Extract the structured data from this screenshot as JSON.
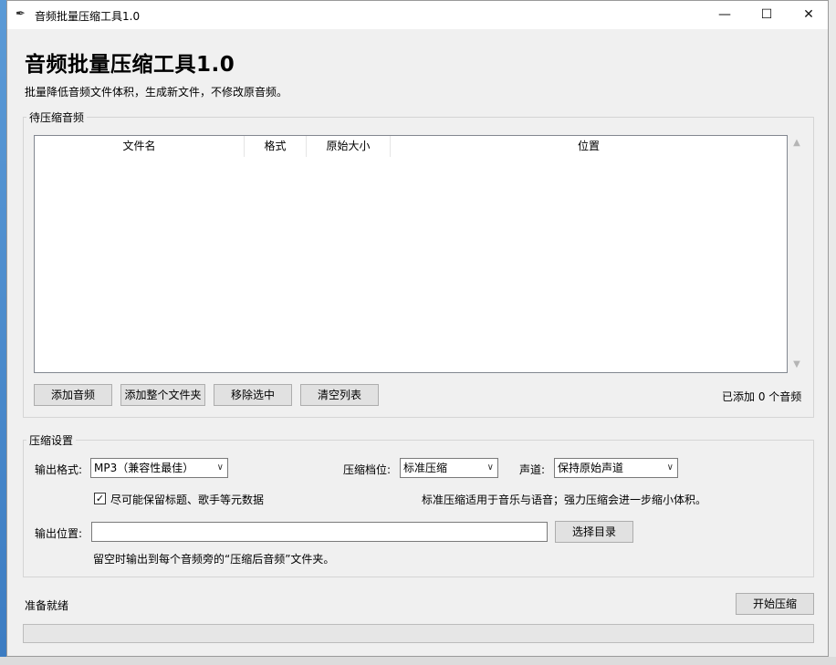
{
  "window": {
    "title": "音频批量压缩工具1.0",
    "minimize": "—",
    "maximize": "☐",
    "close": "✕"
  },
  "header": {
    "title": "音频批量压缩工具1.0",
    "subtitle": "批量降低音频文件体积，生成新文件，不修改原音频。"
  },
  "queue": {
    "group_label": "待压缩音频",
    "columns": [
      "文件名",
      "格式",
      "原始大小",
      "位置"
    ],
    "rows": [],
    "buttons": {
      "add_audio": "添加音频",
      "add_folder": "添加整个文件夹",
      "remove_selected": "移除选中",
      "clear_list": "清空列表"
    },
    "count_text": "已添加 0 个音频"
  },
  "settings": {
    "group_label": "压缩设置",
    "format_label": "输出格式:",
    "format_value": "MP3（兼容性最佳）",
    "level_label": "压缩档位:",
    "level_value": "标准压缩",
    "channel_label": "声道:",
    "channel_value": "保持原始声道",
    "keep_metadata_label": "尽可能保留标题、歌手等元数据",
    "keep_metadata_checked": true,
    "level_hint": "标准压缩适用于音乐与语音；强力压缩会进一步缩小体积。",
    "output_label": "输出位置:",
    "output_value": "",
    "choose_dir": "选择目录",
    "output_hint": "留空时输出到每个音频旁的“压缩后音频”文件夹。"
  },
  "footer": {
    "status": "准备就绪",
    "start_button": "开始压缩",
    "progress": 0
  }
}
